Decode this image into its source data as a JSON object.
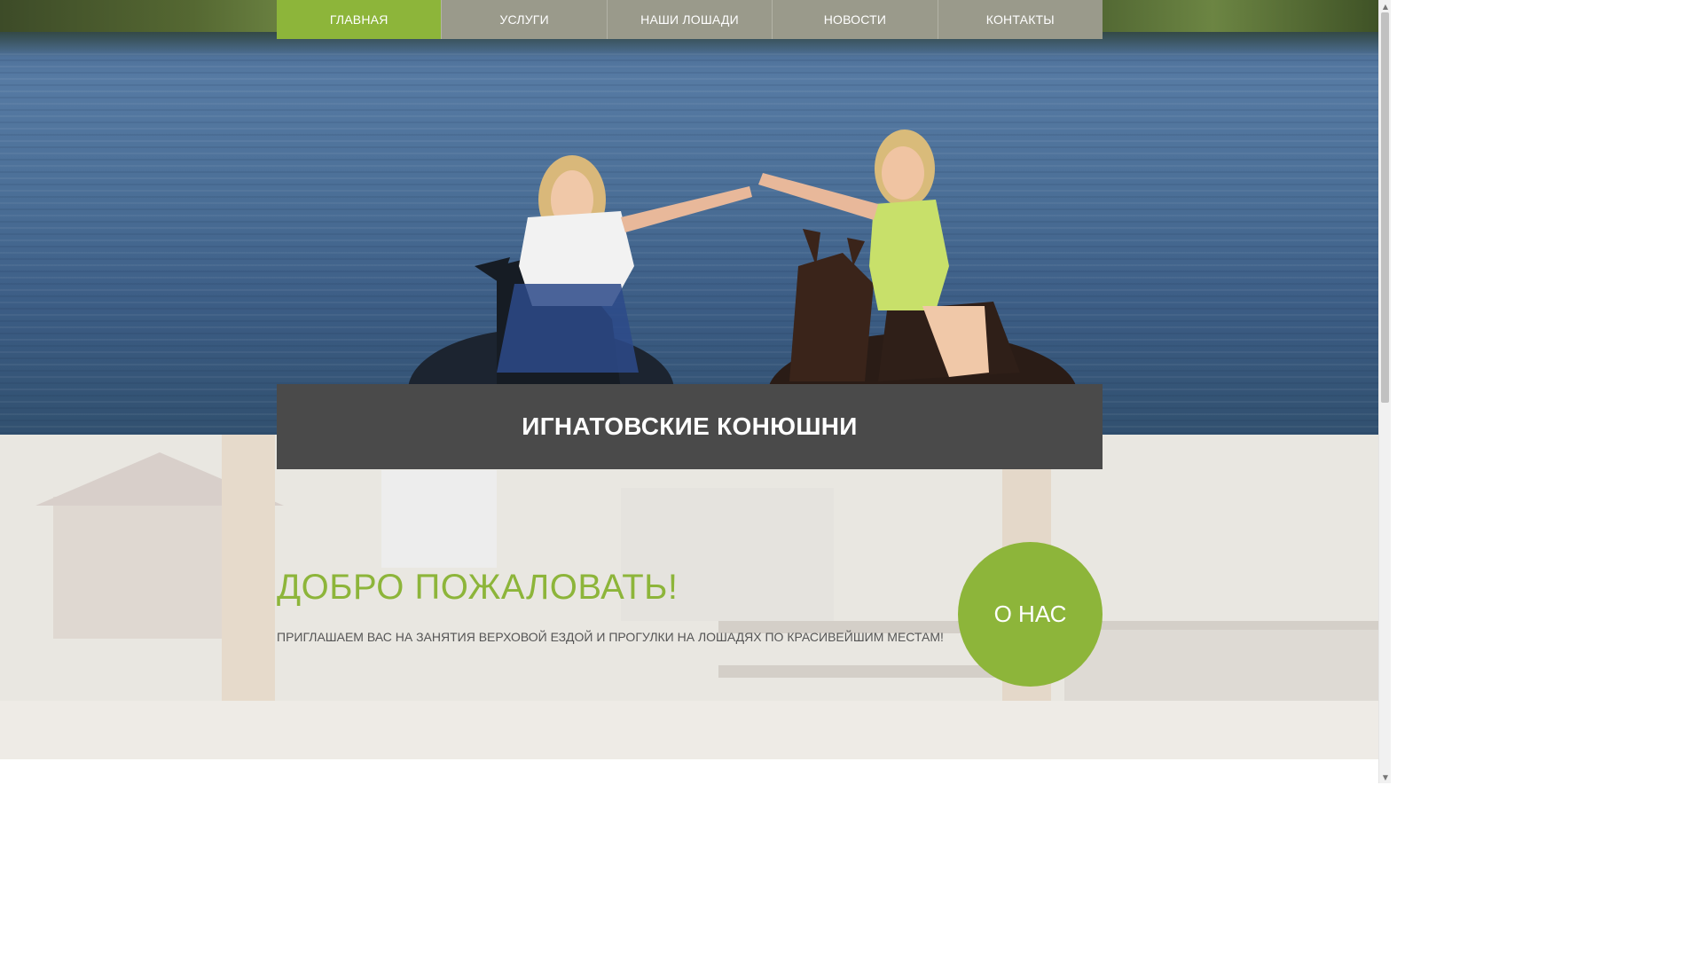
{
  "nav": {
    "items": [
      {
        "label": "ГЛАВНАЯ",
        "active": true
      },
      {
        "label": "УСЛУГИ",
        "active": false
      },
      {
        "label": "НАШИ ЛОШАДИ",
        "active": false
      },
      {
        "label": "НОВОСТИ",
        "active": false
      },
      {
        "label": "КОНТАКТЫ",
        "active": false
      }
    ]
  },
  "hero": {
    "title": "ИГНАТОВСКИЕ КОНЮШНИ"
  },
  "welcome": {
    "heading": "ДОБРО ПОЖАЛОВАТЬ!",
    "text": "ПРИГЛАШАЕМ ВАС НА ЗАНЯТИЯ ВЕРХОВОЙ ЕЗДОЙ И ПРОГУЛКИ НА ЛОШАДЯХ ПО КРАСИВЕЙШИМ МЕСТАМ!",
    "about_label": "О НАС"
  },
  "colors": {
    "accent": "#8db53a",
    "nav_bg": "#9a9a8b",
    "title_bar_bg": "#4a4a4a",
    "body_text": "#555555"
  },
  "icons": {
    "scroll_up": "▲",
    "scroll_down": "▼"
  }
}
